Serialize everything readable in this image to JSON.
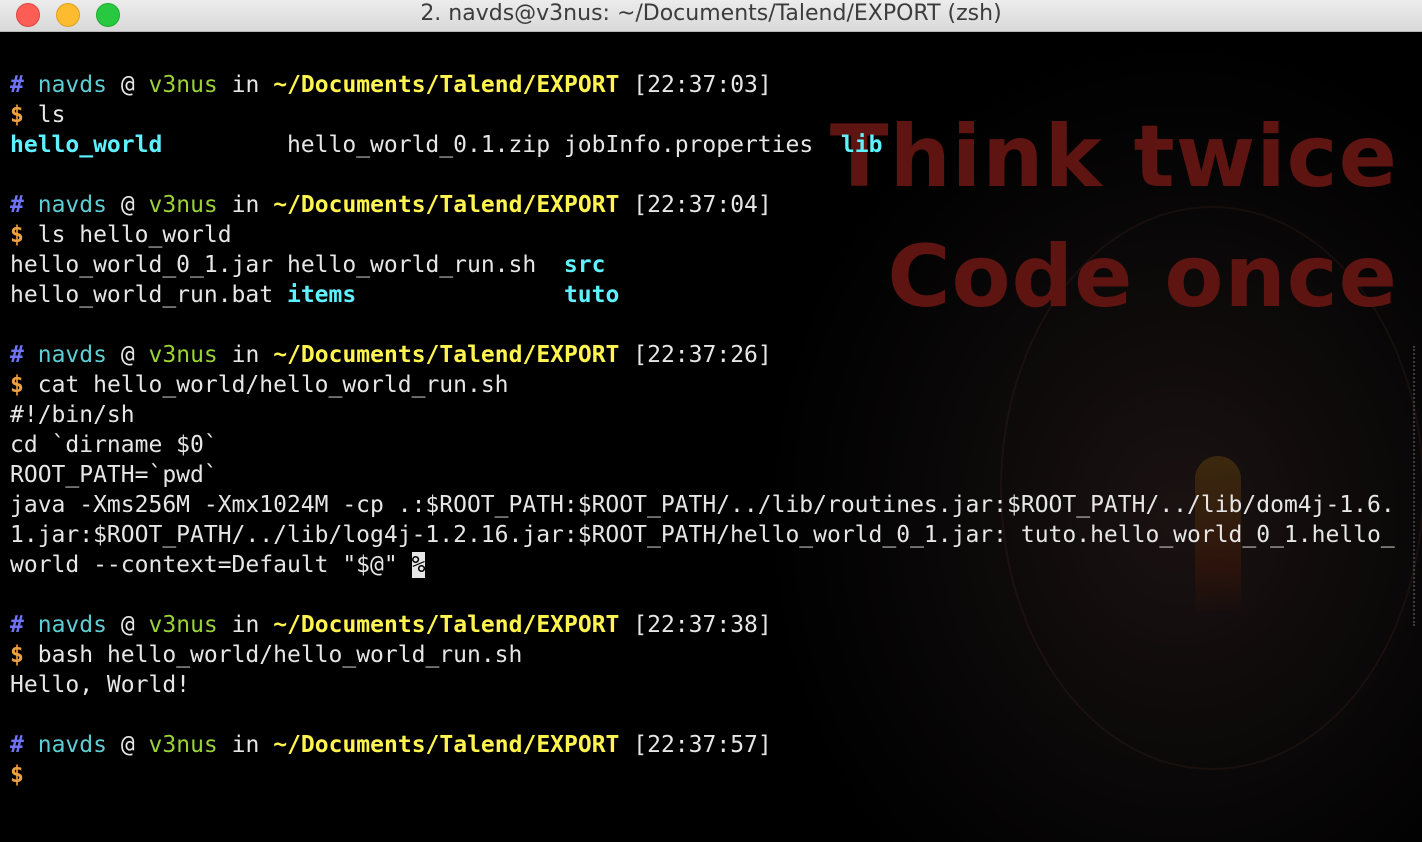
{
  "window": {
    "title": "2. navds@v3nus: ~/Documents/Talend/EXPORT (zsh)"
  },
  "watermark": {
    "line1": "Think twice",
    "line2": "Code once"
  },
  "prompt": {
    "hash": "#",
    "user": "navds",
    "at": "@",
    "host": "v3nus",
    "in": "in",
    "path": "~/Documents/Talend/EXPORT",
    "dollar": "$"
  },
  "session": {
    "p1_time": "[22:37:03]",
    "cmd1": "ls",
    "ls1": [
      "hello_world",
      "hello_world_0.1.zip",
      "jobInfo.properties",
      "lib"
    ],
    "p2_time": "[22:37:04]",
    "cmd2": "ls hello_world",
    "ls2_row1": [
      "hello_world_0_1.jar",
      "hello_world_run.sh",
      "src"
    ],
    "ls2_row2": [
      "hello_world_run.bat",
      "items",
      "tuto"
    ],
    "p3_time": "[22:37:26]",
    "cmd3": "cat hello_world/hello_world_run.sh",
    "cat_output": [
      "#!/bin/sh",
      "cd `dirname $0`",
      "ROOT_PATH=`pwd`",
      "java -Xms256M -Xmx1024M -cp .:$ROOT_PATH:$ROOT_PATH/../lib/routines.jar:$ROOT_PATH/../lib/dom4j-1.6.",
      "1.jar:$ROOT_PATH/../lib/log4j-1.2.16.jar:$ROOT_PATH/hello_world_0_1.jar: tuto.hello_world_0_1.hello_",
      "world --context=Default \"$@\" "
    ],
    "no_newline_mark": "%",
    "p4_time": "[22:37:38]",
    "cmd4": "bash hello_world/hello_world_run.sh",
    "run_output": "Hello, World!",
    "p5_time": "[22:37:57]"
  }
}
